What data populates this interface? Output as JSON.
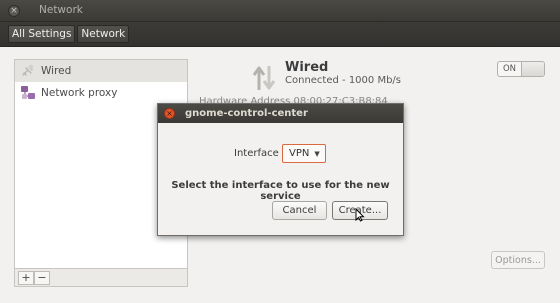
{
  "window": {
    "title": "Network",
    "close_glyph": "×"
  },
  "toolbar": {
    "crumbs": [
      "All Settings",
      "Network"
    ]
  },
  "connections": [
    {
      "label": "Wired",
      "icon": "ethernet-plug-icon",
      "selected": true
    },
    {
      "label": "Network proxy",
      "icon": "network-proxy-icon",
      "selected": false
    }
  ],
  "list_tools": {
    "add": "+",
    "remove": "−"
  },
  "detail": {
    "title": "Wired",
    "status": "Connected - 1000 Mb/s",
    "toggle_label": "ON",
    "hw_address": "Hardware Address  08:00:27:C3:B8:84",
    "options_label": "Options..."
  },
  "dialog": {
    "title": "gnome-control-center",
    "close_glyph": "×",
    "interface_label": "Interface",
    "interface_value": "VPN",
    "chevron": "▼",
    "message": "Select the interface to use for the new service",
    "cancel_label": "Cancel",
    "create_label": "Create..."
  },
  "colors": {
    "accent": "#dd4814",
    "titlebar": "#3c3b37"
  }
}
